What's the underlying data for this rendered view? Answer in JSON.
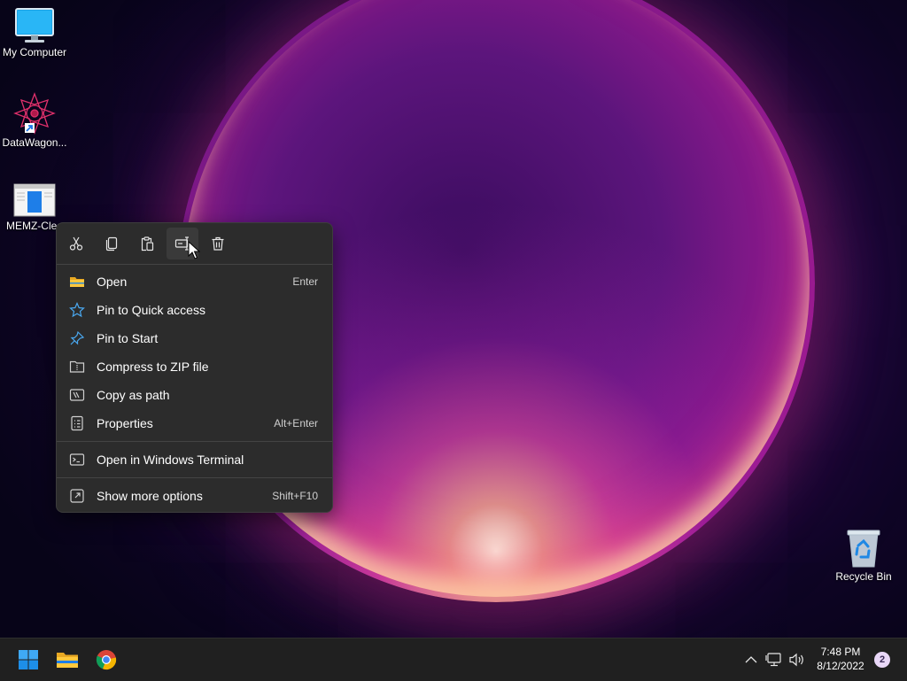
{
  "desktop": {
    "icons": [
      {
        "label": "My Computer",
        "icon": "monitor-icon"
      },
      {
        "label": "DataWagon...",
        "icon": "mandala-shortcut-icon"
      },
      {
        "label": "MEMZ-Clea",
        "icon": "document-icon"
      },
      {
        "label": "Recycle Bin",
        "icon": "recycle-bin-icon"
      }
    ]
  },
  "context_menu": {
    "quick_actions": [
      {
        "name": "cut",
        "icon": "scissors-icon"
      },
      {
        "name": "copy",
        "icon": "copy-icon"
      },
      {
        "name": "paste",
        "icon": "paste-icon"
      },
      {
        "name": "rename",
        "icon": "rename-icon"
      },
      {
        "name": "delete",
        "icon": "trash-icon"
      }
    ],
    "items": [
      {
        "label": "Open",
        "shortcut": "Enter",
        "icon": "folder-icon"
      },
      {
        "label": "Pin to Quick access",
        "shortcut": "",
        "icon": "star-icon"
      },
      {
        "label": "Pin to Start",
        "shortcut": "",
        "icon": "pin-icon"
      },
      {
        "label": "Compress to ZIP file",
        "shortcut": "",
        "icon": "zip-icon"
      },
      {
        "label": "Copy as path",
        "shortcut": "",
        "icon": "path-icon"
      },
      {
        "label": "Properties",
        "shortcut": "Alt+Enter",
        "icon": "properties-icon"
      },
      {
        "label": "Open in Windows Terminal",
        "shortcut": "",
        "icon": "terminal-icon"
      },
      {
        "label": "Show more options",
        "shortcut": "Shift+F10",
        "icon": "more-options-icon"
      }
    ]
  },
  "taskbar": {
    "apps": [
      {
        "name": "start",
        "icon": "windows-icon"
      },
      {
        "name": "file-explorer",
        "icon": "folder-icon"
      },
      {
        "name": "chrome",
        "icon": "chrome-icon"
      }
    ],
    "tray": {
      "icons": [
        "chevron-up-icon",
        "network-icon",
        "volume-icon"
      ],
      "time": "7:48 PM",
      "date": "8/12/2022",
      "notification_count": "2"
    }
  },
  "colors": {
    "menu_bg": "#2c2c2c",
    "taskbar_bg": "#202020",
    "accent_blue": "#0078d4"
  }
}
